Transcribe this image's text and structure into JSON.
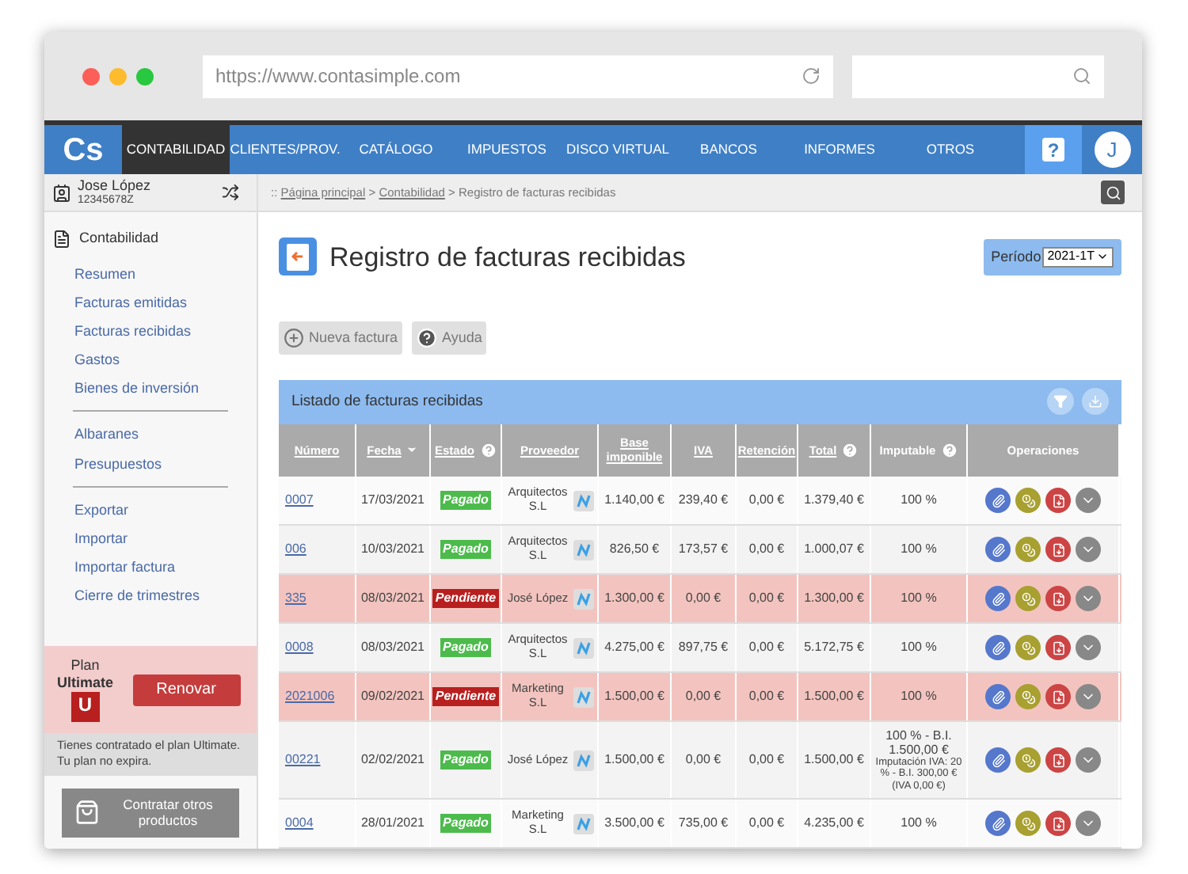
{
  "browser": {
    "url": "https://www.contasimple.com"
  },
  "logo": "Cs",
  "nav": [
    {
      "label": "CONTABILIDAD",
      "selected": true
    },
    {
      "label": "CLIENTES/PROV.",
      "selected": false
    },
    {
      "label": "CATÁLOGO",
      "selected": false
    },
    {
      "label": "IMPUESTOS",
      "selected": false
    },
    {
      "label": "DISCO VIRTUAL",
      "selected": false
    },
    {
      "label": "BANCOS",
      "selected": false
    },
    {
      "label": "INFORMES",
      "selected": false
    },
    {
      "label": "OTROS",
      "selected": false
    }
  ],
  "help_label": "?",
  "avatar": "J",
  "user": {
    "name": "Jose López",
    "id": "12345678Z"
  },
  "breadcrumb": {
    "prefix": "::",
    "separator": ">",
    "links": [
      "Página principal",
      "Contabilidad"
    ],
    "current": "Registro de facturas recibidas"
  },
  "sidebar": {
    "title": "Contabilidad",
    "groups": [
      [
        "Resumen",
        "Facturas emitidas",
        "Facturas recibidas",
        "Gastos",
        "Bienes de inversión"
      ],
      [
        "Albaranes",
        "Presupuestos"
      ],
      [
        "Exportar",
        "Importar",
        "Importar factura",
        "Cierre de trimestres"
      ]
    ]
  },
  "plan": {
    "label": "Plan",
    "name": "Ultimate",
    "badge": "U",
    "renew": "Renovar",
    "note": "Tienes contratado el plan Ultimate. Tu plan no expira.",
    "more": "Contratar otros productos"
  },
  "page_title": "Registro de facturas recibidas",
  "period": {
    "label": "Período",
    "value": "2021-1T"
  },
  "actions": [
    "Nueva factura",
    "Ayuda"
  ],
  "table": {
    "title": "Listado de facturas recibidas",
    "columns": [
      {
        "label": "Número",
        "sortable": true,
        "help": false,
        "sorted": false
      },
      {
        "label": "Fecha",
        "sortable": true,
        "help": false,
        "sorted": true
      },
      {
        "label": "Estado",
        "sortable": true,
        "help": true,
        "sorted": false
      },
      {
        "label": "Proveedor",
        "sortable": true,
        "help": false,
        "sorted": false
      },
      {
        "label": "Base imponible",
        "sortable": true,
        "help": false,
        "sorted": false
      },
      {
        "label": "IVA",
        "sortable": true,
        "help": false,
        "sorted": false
      },
      {
        "label": "Retención",
        "sortable": true,
        "help": false,
        "sorted": false
      },
      {
        "label": "Total",
        "sortable": true,
        "help": true,
        "sorted": false
      },
      {
        "label": "Imputable",
        "sortable": false,
        "help": true,
        "sorted": false
      },
      {
        "label": "Operaciones",
        "sortable": false,
        "help": false,
        "sorted": false
      }
    ],
    "rows": [
      {
        "numero": "0007",
        "fecha": "17/03/2021",
        "estado": {
          "label": "Pagado",
          "kind": "paid"
        },
        "proveedor": "Arquitectos S.L",
        "base": "1.140,00 €",
        "iva": "239,40 €",
        "retencion": "0,00 €",
        "total": "1.379,40 €",
        "imputable": "100 %"
      },
      {
        "numero": "006",
        "fecha": "10/03/2021",
        "estado": {
          "label": "Pagado",
          "kind": "paid"
        },
        "proveedor": "Arquitectos S.L",
        "base": "826,50 €",
        "iva": "173,57 €",
        "retencion": "0,00 €",
        "total": "1.000,07 €",
        "imputable": "100 %"
      },
      {
        "numero": "335",
        "fecha": "08/03/2021",
        "estado": {
          "label": "Pendiente",
          "kind": "pending"
        },
        "proveedor": "José López",
        "base": "1.300,00 €",
        "iva": "0,00 €",
        "retencion": "0,00 €",
        "total": "1.300,00 €",
        "imputable": "100 %"
      },
      {
        "numero": "0008",
        "fecha": "08/03/2021",
        "estado": {
          "label": "Pagado",
          "kind": "paid"
        },
        "proveedor": "Arquitectos S.L",
        "base": "4.275,00 €",
        "iva": "897,75 €",
        "retencion": "0,00 €",
        "total": "5.172,75 €",
        "imputable": "100 %"
      },
      {
        "numero": "2021006",
        "fecha": "09/02/2021",
        "estado": {
          "label": "Pendiente",
          "kind": "pending"
        },
        "proveedor": "Marketing S.L",
        "base": "1.500,00 €",
        "iva": "0,00 €",
        "retencion": "0,00 €",
        "total": "1.500,00 €",
        "imputable": "100 %"
      },
      {
        "numero": "00221",
        "fecha": "02/02/2021",
        "estado": {
          "label": "Pagado",
          "kind": "paid"
        },
        "proveedor": "José López",
        "base": "1.500,00 €",
        "iva": "0,00 €",
        "retencion": "0,00 €",
        "total": "1.500,00 €",
        "imputable": "100 % - B.I. 1.500,00 €",
        "imputable_note": "Imputación IVA: 20 % - B.I. 300,00 € (IVA 0,00 €)"
      },
      {
        "numero": "0004",
        "fecha": "28/01/2021",
        "estado": {
          "label": "Pagado",
          "kind": "paid"
        },
        "proveedor": "Marketing S.L",
        "base": "3.500,00 €",
        "iva": "735,00 €",
        "retencion": "0,00 €",
        "total": "4.235,00 €",
        "imputable": "100 %"
      }
    ]
  }
}
